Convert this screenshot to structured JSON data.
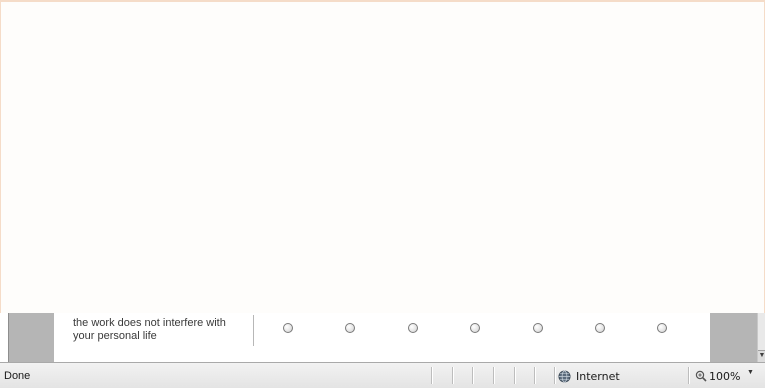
{
  "survey": {
    "question_line1": "the work does not interfere with",
    "question_line2": "your personal life",
    "options": [
      {
        "selected": false
      },
      {
        "selected": false
      },
      {
        "selected": false
      },
      {
        "selected": false
      },
      {
        "selected": false
      },
      {
        "selected": false
      },
      {
        "selected": false
      }
    ]
  },
  "statusbar": {
    "status": "Done",
    "zone": "Internet",
    "zoom": "100%",
    "zoom_arrow": "▼",
    "scroll_down": "▼"
  },
  "colors": {
    "page_bg": "#fefdfb",
    "gutter": "#b5b5b5",
    "statusbar_bg": "#ececec"
  },
  "icons": {
    "zone_icon": "globe-icon",
    "zoom_icon": "magnifier-icon"
  }
}
